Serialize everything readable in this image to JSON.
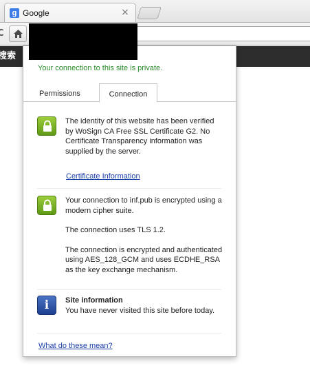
{
  "browser": {
    "tab": {
      "title": "Google",
      "favicon_letter": "g",
      "close_glyph": "×"
    },
    "toolbar": {
      "reload_glyph": "C"
    }
  },
  "page": {
    "header_text": "搜索"
  },
  "bubble": {
    "private_message": "Your connection to this site is private.",
    "tabs": [
      {
        "label": "Permissions",
        "selected": false
      },
      {
        "label": "Connection",
        "selected": true
      }
    ],
    "identity": {
      "text": "The identity of this website has been verified by WoSign CA Free SSL Certificate G2. No Certificate Transparency information was supplied by the server.",
      "link": "Certificate Information"
    },
    "encryption": {
      "p1": "Your connection to inf.pub is encrypted using a modern cipher suite.",
      "p2": "The connection uses TLS 1.2.",
      "p3": "The connection is encrypted and authenticated using AES_128_GCM and uses ECDHE_RSA as the key exchange mechanism."
    },
    "site_info": {
      "title": "Site information",
      "text": "You have never visited this site before today.",
      "icon_glyph": "i"
    },
    "help_link": "What do these mean?"
  },
  "colors": {
    "secure_green": "#2a8a2a",
    "link_blue": "#1a3ea8",
    "lock_green": "#6fa81f",
    "info_blue": "#2b4fa3"
  },
  "icons": [
    "google-favicon",
    "close-icon",
    "reload-icon",
    "home-icon",
    "lock-icon",
    "info-icon"
  ]
}
